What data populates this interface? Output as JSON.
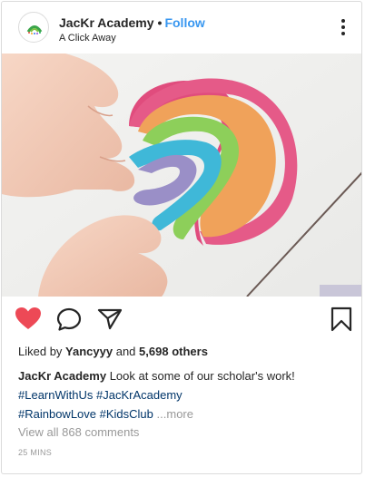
{
  "header": {
    "username": "JacKr Academy",
    "separator": "•",
    "follow_label": "Follow",
    "location": "A Click Away"
  },
  "photo": {
    "subject": "child shaping rainbow play-dough"
  },
  "actions": {
    "like_icon": "heart-icon",
    "liked": true,
    "like_color": "#ed4956",
    "comment_icon": "comment-icon",
    "share_icon": "share-icon",
    "save_icon": "bookmark-icon"
  },
  "likes": {
    "prefix": "Liked by",
    "user": "Yancyyy",
    "middle": "and",
    "count": "5,698 others"
  },
  "caption": {
    "username": "JacKr Academy",
    "text": "Look at some of our scholar's work!",
    "hashtags": [
      "#LearnWithUs",
      "#JacKrAcademy",
      "#RainbowLove",
      "#KidsClub"
    ],
    "more_label": "...more"
  },
  "comments_link": "View all 868 comments",
  "timestamp": "25 MINS",
  "colors": {
    "link_blue": "#3897f0",
    "hashtag_blue": "#003569",
    "muted": "#999999"
  }
}
